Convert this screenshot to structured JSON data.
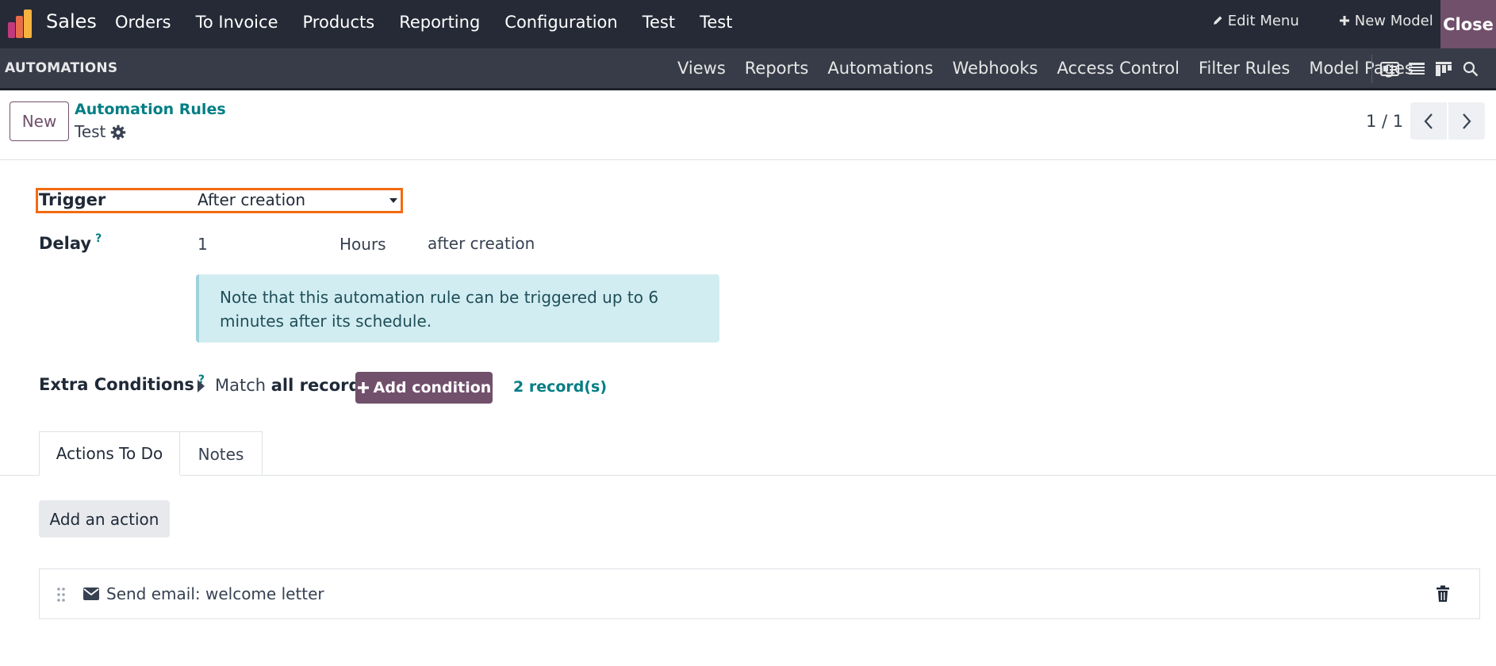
{
  "topbar": {
    "app_name": "Sales",
    "menu": [
      "Orders",
      "To Invoice",
      "Products",
      "Reporting",
      "Configuration",
      "Test",
      "Test"
    ],
    "edit_menu": "Edit Menu",
    "new_model": "New Model",
    "close": "Close"
  },
  "subbar": {
    "title": "AUTOMATIONS",
    "nav": [
      "Views",
      "Reports",
      "Automations",
      "Webhooks",
      "Access Control",
      "Filter Rules",
      "Model Pages"
    ],
    "view_icons": [
      "form-view-icon",
      "list-view-icon",
      "kanban-view-icon",
      "search-icon"
    ]
  },
  "control": {
    "new_label": "New",
    "breadcrumb_parent": "Automation Rules",
    "breadcrumb_current": "Test",
    "pager": "1 / 1"
  },
  "form": {
    "trigger_label": "Trigger",
    "trigger_value": "After creation",
    "delay_label": "Delay",
    "help_mark": "?",
    "delay_value": "1",
    "delay_unit": "Hours",
    "delay_suffix": "after creation",
    "note": "Note that this automation rule can be triggered up to 6 minutes after its schedule.",
    "extra_label": "Extra Conditions",
    "match_prefix": "Match",
    "match_bold": "all records",
    "add_condition": "Add condition",
    "records": "2 record(s)"
  },
  "tabs": [
    "Actions To Do",
    "Notes"
  ],
  "actions": {
    "add_label": "Add an action",
    "items": [
      {
        "label": "Send email: welcome letter"
      }
    ]
  },
  "colors": {
    "navbar": "#262a36",
    "subbar": "#373c48",
    "primary": "#71506b",
    "link": "#017e84",
    "highlight": "#f26b11",
    "note_bg": "#d2edf1"
  }
}
